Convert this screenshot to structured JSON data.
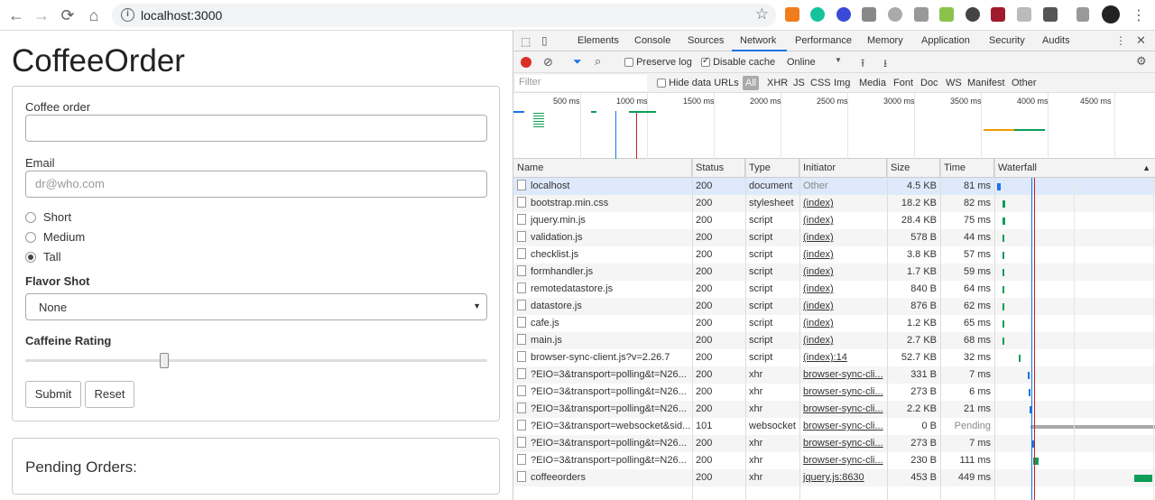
{
  "browser": {
    "url": "localhost:3000"
  },
  "page": {
    "title": "CoffeeOrder",
    "coffee_order_label": "Coffee order",
    "coffee_order_value": "",
    "email_label": "Email",
    "email_placeholder": "dr@who.com",
    "sizes": [
      {
        "label": "Short",
        "checked": false
      },
      {
        "label": "Medium",
        "checked": false
      },
      {
        "label": "Tall",
        "checked": true
      }
    ],
    "flavor_label": "Flavor Shot",
    "flavor_value": "None",
    "caffeine_label": "Caffeine Rating",
    "caffeine_value": 0.3,
    "submit_label": "Submit",
    "reset_label": "Reset",
    "pending_title": "Pending Orders:"
  },
  "devtools": {
    "tabs": [
      "Elements",
      "Console",
      "Sources",
      "Network",
      "Performance",
      "Memory",
      "Application",
      "Security",
      "Audits"
    ],
    "active_tab": "Network",
    "toolbar": {
      "preserve_log": "Preserve log",
      "disable_cache": "Disable cache",
      "throttle": "Online"
    },
    "filter": {
      "placeholder": "Filter",
      "hide_data_urls": "Hide data URLs",
      "types": [
        "All",
        "XHR",
        "JS",
        "CSS",
        "Img",
        "Media",
        "Font",
        "Doc",
        "WS",
        "Manifest",
        "Other"
      ]
    },
    "overview_ticks": [
      "500 ms",
      "1000 ms",
      "1500 ms",
      "2000 ms",
      "2500 ms",
      "3000 ms",
      "3500 ms",
      "4000 ms",
      "4500 ms"
    ],
    "columns": [
      "Name",
      "Status",
      "Type",
      "Initiator",
      "Size",
      "Time",
      "Waterfall"
    ],
    "requests": [
      {
        "name": "localhost",
        "status": "200",
        "type": "document",
        "initiator": "Other",
        "size": "4.5 KB",
        "time": "81 ms"
      },
      {
        "name": "bootstrap.min.css",
        "status": "200",
        "type": "stylesheet",
        "initiator": "(index)",
        "size": "18.2 KB",
        "time": "82 ms"
      },
      {
        "name": "jquery.min.js",
        "status": "200",
        "type": "script",
        "initiator": "(index)",
        "size": "28.4 KB",
        "time": "75 ms"
      },
      {
        "name": "validation.js",
        "status": "200",
        "type": "script",
        "initiator": "(index)",
        "size": "578 B",
        "time": "44 ms"
      },
      {
        "name": "checklist.js",
        "status": "200",
        "type": "script",
        "initiator": "(index)",
        "size": "3.8 KB",
        "time": "57 ms"
      },
      {
        "name": "formhandler.js",
        "status": "200",
        "type": "script",
        "initiator": "(index)",
        "size": "1.7 KB",
        "time": "59 ms"
      },
      {
        "name": "remotedatastore.js",
        "status": "200",
        "type": "script",
        "initiator": "(index)",
        "size": "840 B",
        "time": "64 ms"
      },
      {
        "name": "datastore.js",
        "status": "200",
        "type": "script",
        "initiator": "(index)",
        "size": "876 B",
        "time": "62 ms"
      },
      {
        "name": "cafe.js",
        "status": "200",
        "type": "script",
        "initiator": "(index)",
        "size": "1.2 KB",
        "time": "65 ms"
      },
      {
        "name": "main.js",
        "status": "200",
        "type": "script",
        "initiator": "(index)",
        "size": "2.7 KB",
        "time": "68 ms"
      },
      {
        "name": "browser-sync-client.js?v=2.26.7",
        "status": "200",
        "type": "script",
        "initiator": "(index):14",
        "size": "52.7 KB",
        "time": "32 ms"
      },
      {
        "name": "?EIO=3&transport=polling&t=N26...",
        "status": "200",
        "type": "xhr",
        "initiator": "browser-sync-cli...",
        "size": "331 B",
        "time": "7 ms"
      },
      {
        "name": "?EIO=3&transport=polling&t=N26...",
        "status": "200",
        "type": "xhr",
        "initiator": "browser-sync-cli...",
        "size": "273 B",
        "time": "6 ms"
      },
      {
        "name": "?EIO=3&transport=polling&t=N26...",
        "status": "200",
        "type": "xhr",
        "initiator": "browser-sync-cli...",
        "size": "2.2 KB",
        "time": "21 ms"
      },
      {
        "name": "?EIO=3&transport=websocket&sid...",
        "status": "101",
        "type": "websocket",
        "initiator": "browser-sync-cli...",
        "size": "0 B",
        "time": "Pending"
      },
      {
        "name": "?EIO=3&transport=polling&t=N26...",
        "status": "200",
        "type": "xhr",
        "initiator": "browser-sync-cli...",
        "size": "273 B",
        "time": "7 ms"
      },
      {
        "name": "?EIO=3&transport=polling&t=N26...",
        "status": "200",
        "type": "xhr",
        "initiator": "browser-sync-cli...",
        "size": "230 B",
        "time": "111 ms"
      },
      {
        "name": "coffeeorders",
        "status": "200",
        "type": "xhr",
        "initiator": "jquery.js:8630",
        "size": "453 B",
        "time": "449 ms"
      }
    ]
  }
}
